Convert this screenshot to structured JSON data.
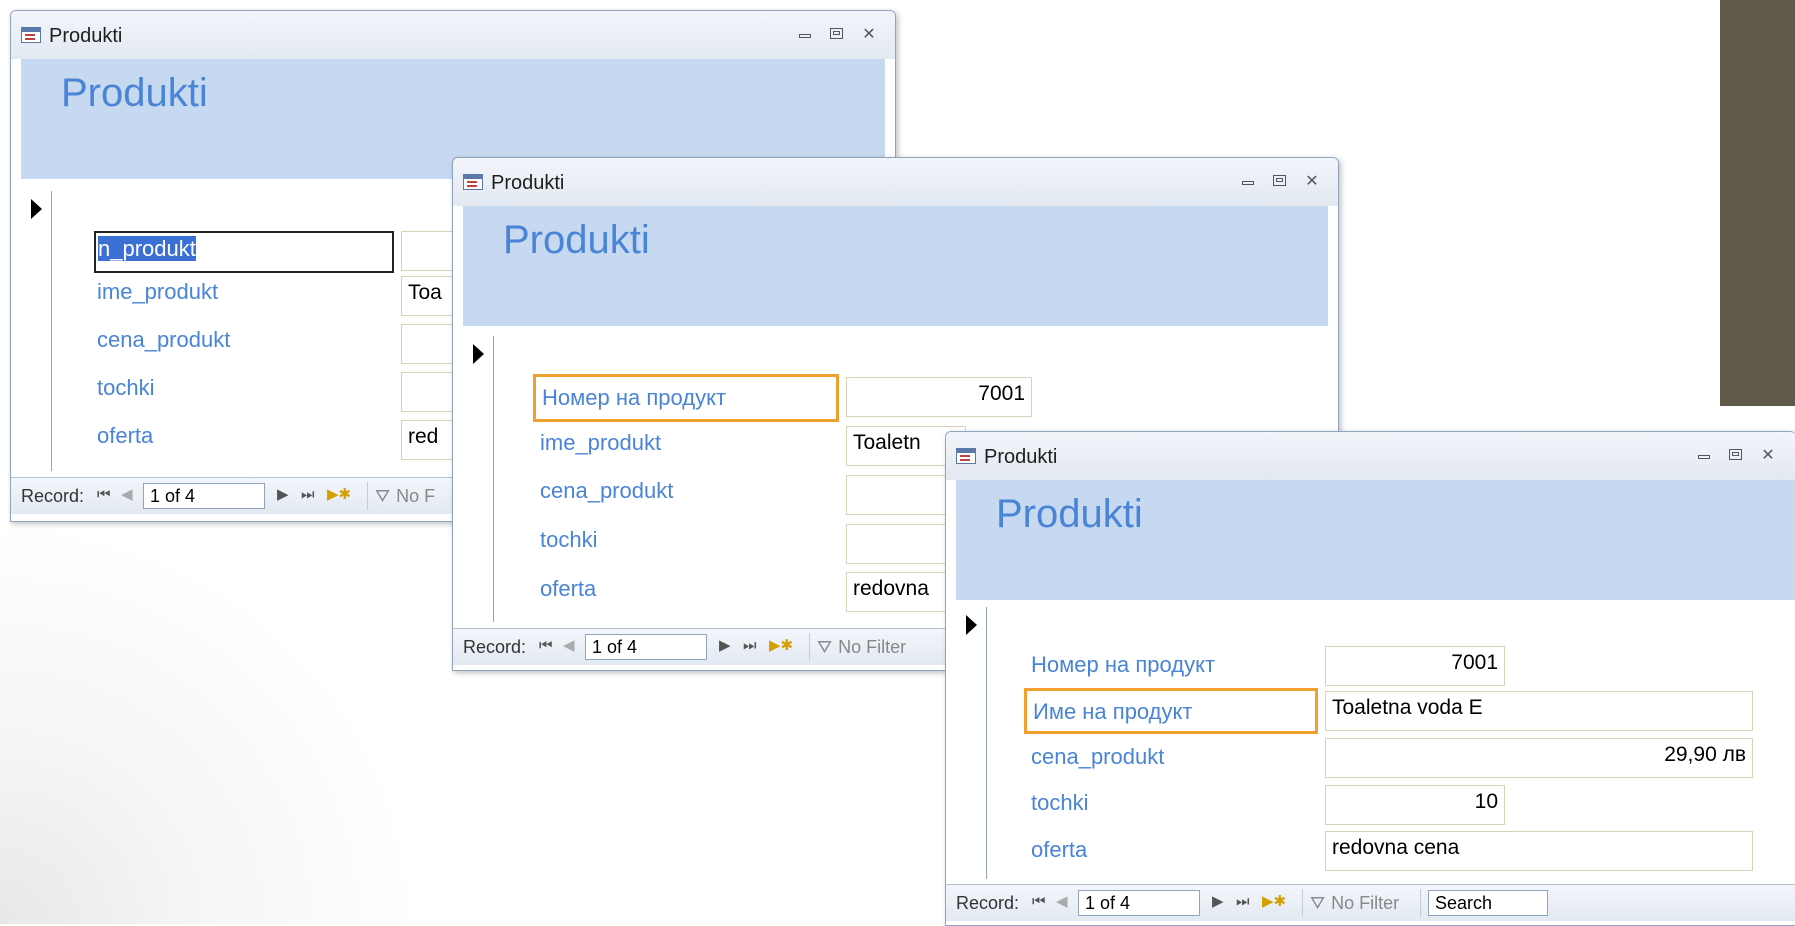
{
  "windows": [
    {
      "title": "Produkti",
      "header_title": "Produkti",
      "fields": [
        {
          "label_visible": "n_produkt",
          "value": ""
        },
        {
          "label": "ime_produkt",
          "value": "Toa"
        },
        {
          "label": "cena_produkt",
          "value": ""
        },
        {
          "label": "tochki",
          "value": ""
        },
        {
          "label": "oferta",
          "value": "red"
        }
      ],
      "nav": {
        "label": "Record:",
        "record": "1 of 4",
        "filter": "No F"
      }
    },
    {
      "title": "Produkti",
      "header_title": "Produkti",
      "fields": [
        {
          "label": "Номер на продукт",
          "value": "7001"
        },
        {
          "label": "ime_produkt",
          "value": "Toaletn"
        },
        {
          "label": "cena_produkt",
          "value": ""
        },
        {
          "label": "tochki",
          "value": ""
        },
        {
          "label": "oferta",
          "value": "redovna"
        }
      ],
      "nav": {
        "label": "Record:",
        "record": "1 of 4",
        "filter": "No Filter"
      }
    },
    {
      "title": "Produkti",
      "header_title": "Produkti",
      "fields": [
        {
          "label": "Номер на продукт",
          "value": "7001"
        },
        {
          "label": "Име на продукт",
          "value": "Toaletna voda E"
        },
        {
          "label": "cena_produkt",
          "value": "29,90 лв"
        },
        {
          "label": "tochki",
          "value": "10"
        },
        {
          "label": "oferta",
          "value": "redovna cena"
        }
      ],
      "nav": {
        "label": "Record:",
        "record": "1 of 4",
        "filter": "No Filter",
        "search": "Search"
      }
    }
  ],
  "colors": {
    "header_bg": "#c6d9f0",
    "label_text": "#4a84d6",
    "highlight_box": "#f0a030",
    "side_bar": "#5f5a48"
  },
  "icons": {
    "form_icon": "form-icon",
    "minimize": "minimize-icon",
    "maximize": "maximize-icon",
    "close": "close-icon"
  }
}
